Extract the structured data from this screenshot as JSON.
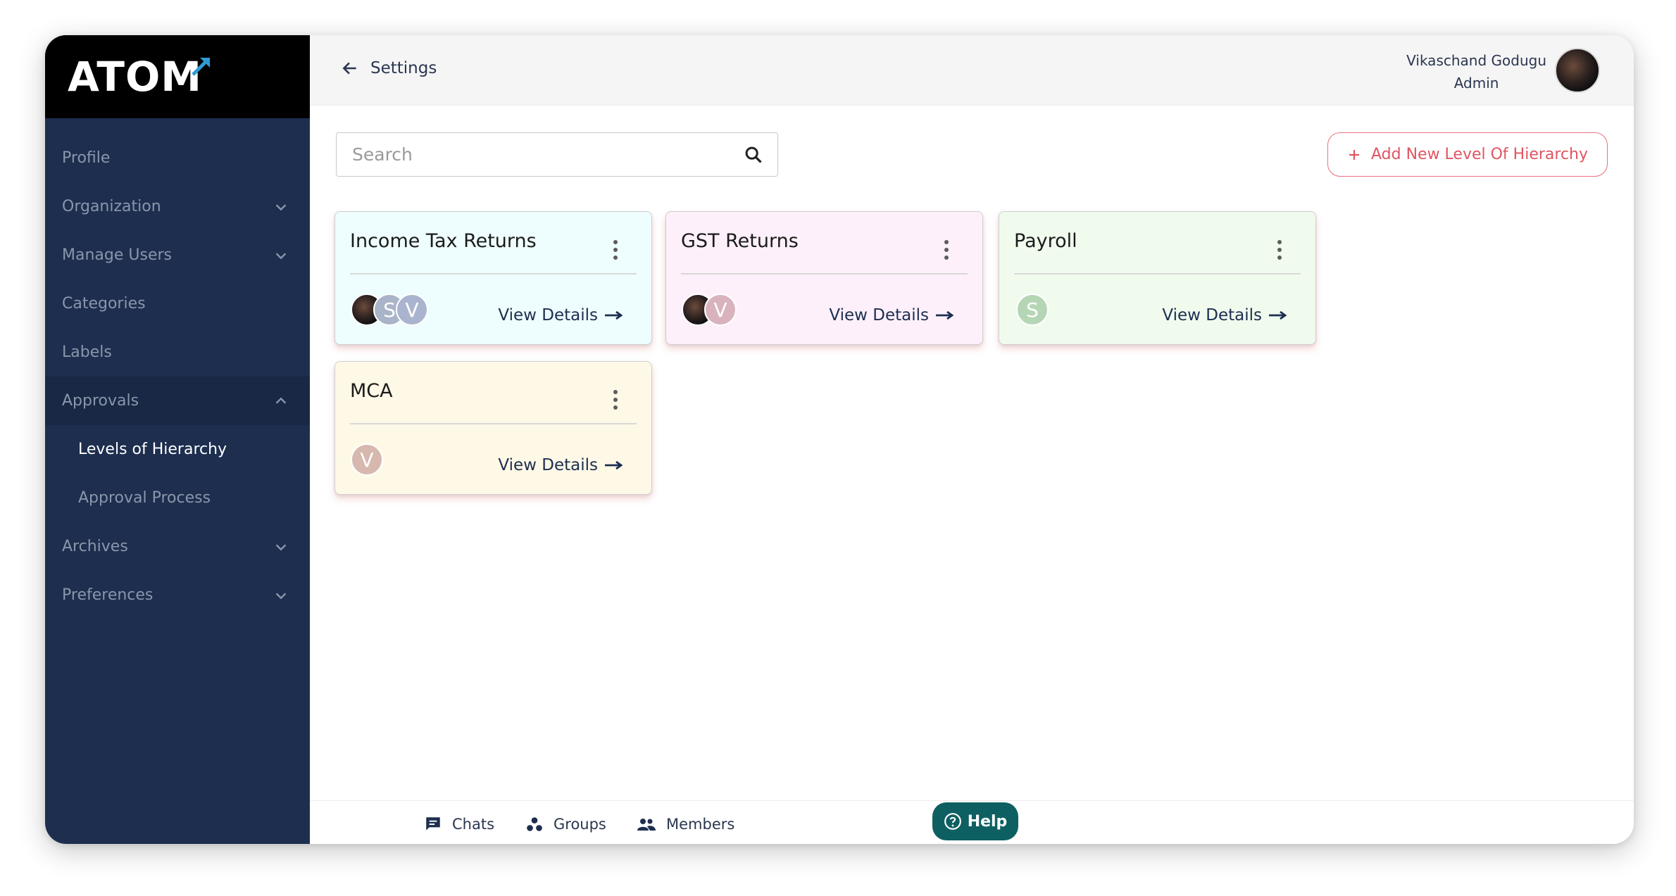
{
  "brand": {
    "logo_text": "ATOM"
  },
  "sidebar": {
    "items": [
      {
        "label": "Profile"
      },
      {
        "label": "Organization"
      },
      {
        "label": "Manage Users"
      },
      {
        "label": "Categories"
      },
      {
        "label": "Labels"
      },
      {
        "label": "Approvals"
      },
      {
        "label": "Levels of Hierarchy"
      },
      {
        "label": "Approval Process"
      },
      {
        "label": "Archives"
      },
      {
        "label": "Preferences"
      }
    ]
  },
  "header": {
    "back_label": "Settings",
    "user_name": "Vikaschand Godugu",
    "user_role": "Admin"
  },
  "search": {
    "placeholder": "Search"
  },
  "actions": {
    "add_label": "Add New Level Of Hierarchy"
  },
  "cards": [
    {
      "title": "Income Tax Returns",
      "link": "View Details",
      "avatars": [
        "",
        "S",
        "V"
      ],
      "bg": "#eefdfd"
    },
    {
      "title": "GST Returns",
      "link": "View Details",
      "avatars": [
        "",
        "V"
      ],
      "bg": "#fdf0fa"
    },
    {
      "title": "Payroll",
      "link": "View Details",
      "avatars": [
        "S"
      ],
      "bg": "#f0fbee"
    },
    {
      "title": "MCA",
      "link": "View Details",
      "avatars": [
        "V"
      ],
      "bg": "#fef8e6"
    }
  ],
  "bottom": {
    "chats": "Chats",
    "groups": "Groups",
    "members": "Members",
    "help": "Help"
  },
  "colors": {
    "sidebar": "#1d2e4f",
    "accent": "#e05561",
    "help": "#0e5f62"
  }
}
